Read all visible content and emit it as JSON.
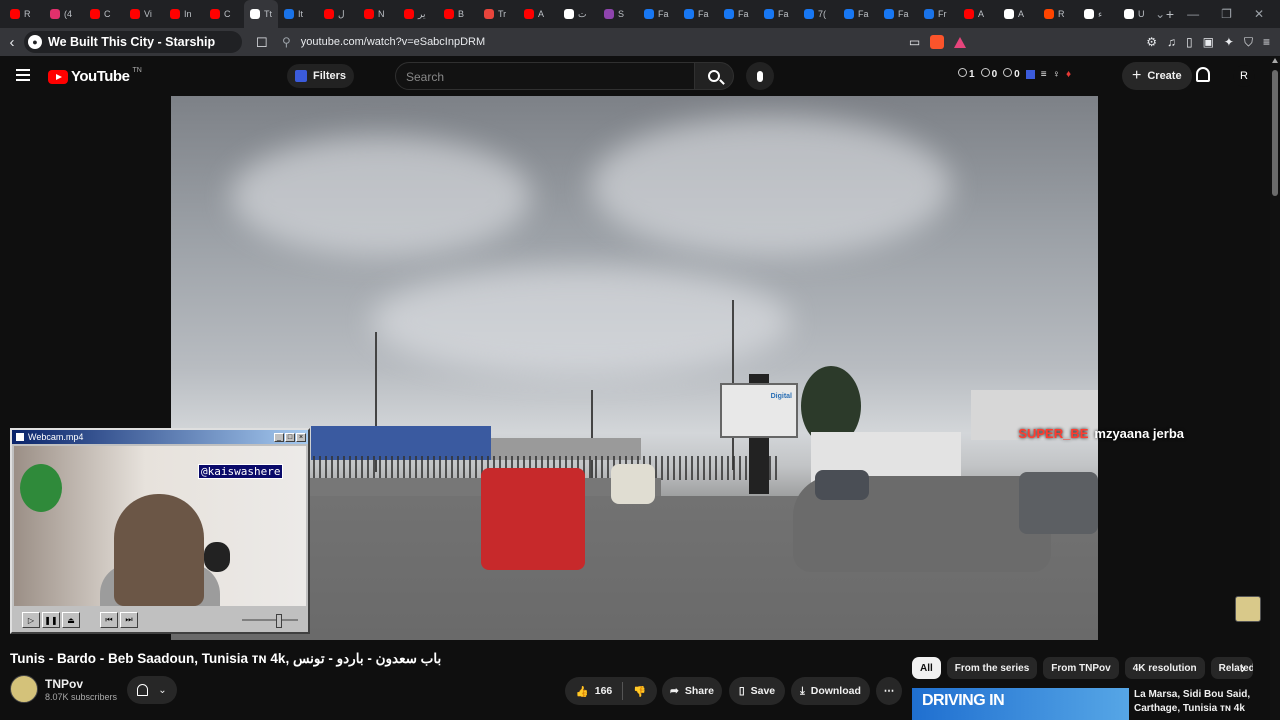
{
  "tabs": [
    {
      "label": "R",
      "color": "#ff0000"
    },
    {
      "label": "(4",
      "color": "#e1306c"
    },
    {
      "label": "C",
      "color": "#ff0000"
    },
    {
      "label": "Vi",
      "color": "#ff0000"
    },
    {
      "label": "In",
      "color": "#ff0000"
    },
    {
      "label": "C",
      "color": "#ff0000"
    },
    {
      "label": "Tt",
      "color": "#ffffff",
      "active": true
    },
    {
      "label": "It",
      "color": "#1a73e8"
    },
    {
      "label": "ل",
      "color": "#ff0000"
    },
    {
      "label": "N",
      "color": "#ff0000"
    },
    {
      "label": "ير",
      "color": "#ff0000"
    },
    {
      "label": "B",
      "color": "#ff0000"
    },
    {
      "label": "Tr",
      "color": "#e8453c"
    },
    {
      "label": "A",
      "color": "#ff0000"
    },
    {
      "label": "ت",
      "color": "#ffffff"
    },
    {
      "label": "S",
      "color": "#8e44ad"
    },
    {
      "label": "Fa",
      "color": "#1877f2"
    },
    {
      "label": "Fa",
      "color": "#1877f2"
    },
    {
      "label": "Fa",
      "color": "#1877f2"
    },
    {
      "label": "Fa",
      "color": "#1877f2"
    },
    {
      "label": "7(",
      "color": "#1877f2"
    },
    {
      "label": "Fa",
      "color": "#1877f2"
    },
    {
      "label": "Fa",
      "color": "#1877f2"
    },
    {
      "label": "Fr",
      "color": "#1a73e8"
    },
    {
      "label": "A",
      "color": "#ff0000"
    },
    {
      "label": "A",
      "color": "#ffffff"
    },
    {
      "label": "R",
      "color": "#ff4500"
    },
    {
      "label": "ء",
      "color": "#ffffff"
    },
    {
      "label": "U",
      "color": "#ffffff"
    }
  ],
  "active_tab_close": "✕",
  "new_tab": "+",
  "window_controls": [
    "⌄",
    "—",
    "❐",
    "✕"
  ],
  "toolbar": {
    "page_title": "We Built This City - Starship",
    "url": "youtube.com/watch?v=eSabcInpDRM"
  },
  "yt_header": {
    "logo_text": "YouTube",
    "logo_tm": "TN",
    "filters_label": "Filters",
    "search_placeholder": "Search",
    "stats": [
      "1",
      "0",
      "0"
    ],
    "create_label": "Create",
    "avatar_letter": "R"
  },
  "player": {
    "overlay_name_red": "SUPER_BE",
    "overlay_name_white": "mzyaana jerba",
    "billboard_text": "Digital"
  },
  "webcam": {
    "window_title": "Webcam.mp4",
    "tag": "@kaiswashere"
  },
  "video": {
    "title": "Tunis - Bardo - Beb Saadoun, Tunisia ᴛɴ 4k, باب سعدون - باردو - تونس",
    "channel": "TNPov",
    "subscribers": "8.07K subscribers",
    "likes": "166",
    "share_label": "Share",
    "save_label": "Save",
    "download_label": "Download"
  },
  "chips": [
    "All",
    "From the series",
    "From TNPov",
    "4K resolution",
    "Related"
  ],
  "recommended": {
    "thumb_text": "DRIVING IN",
    "title": "La Marsa, Sidi Bou Said, Carthage, Tunisia ᴛɴ 4k"
  },
  "colors": {
    "yt_red": "#ff0000",
    "background": "#0f0f0f",
    "overlay_red": "#ff3b2f"
  }
}
